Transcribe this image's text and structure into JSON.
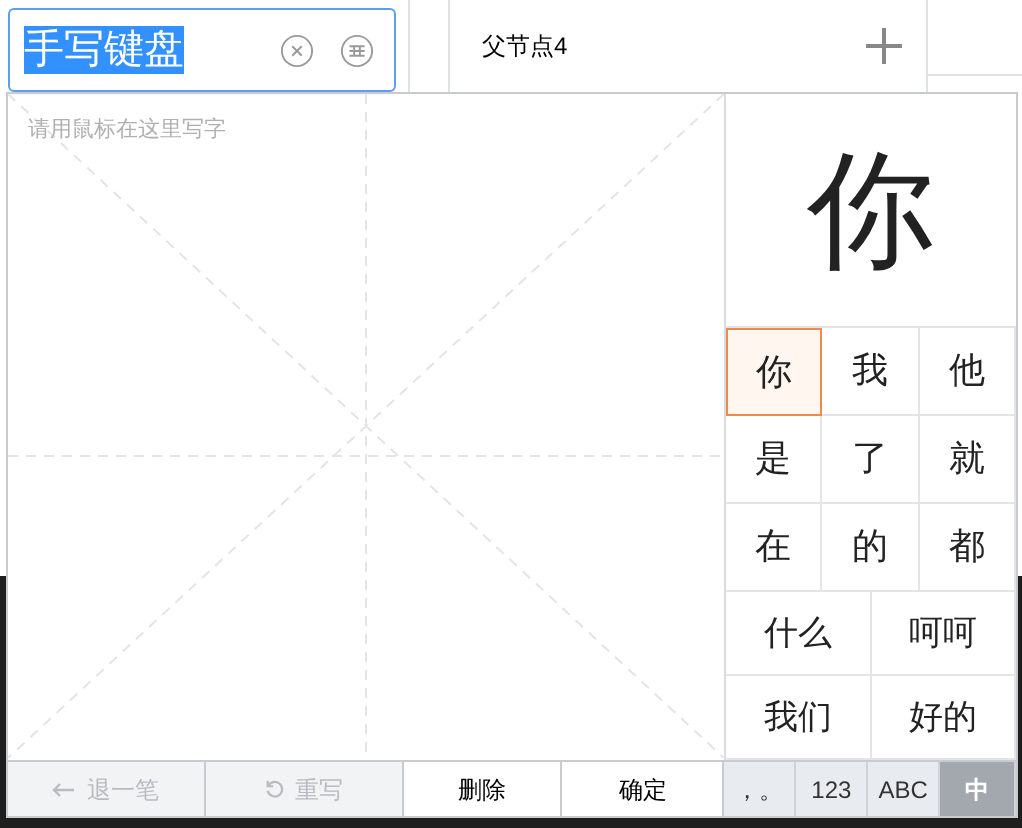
{
  "input": {
    "value": "手写键盘",
    "text_selected": true
  },
  "background": {
    "node_label": "父节点4"
  },
  "canvas": {
    "placeholder": "请用鼠标在这里写字"
  },
  "preview": "你",
  "candidates": [
    {
      "text": "你",
      "selected": true
    },
    {
      "text": "我",
      "selected": false
    },
    {
      "text": "他",
      "selected": false
    },
    {
      "text": "是",
      "selected": false
    },
    {
      "text": "了",
      "selected": false
    },
    {
      "text": "就",
      "selected": false
    },
    {
      "text": "在",
      "selected": false
    },
    {
      "text": "的",
      "selected": false
    },
    {
      "text": "都",
      "selected": false
    }
  ],
  "phrases": [
    {
      "text": "什么"
    },
    {
      "text": "呵呵"
    },
    {
      "text": "我们"
    },
    {
      "text": "好的"
    }
  ],
  "actions": [
    {
      "label": "退一笔",
      "kind": "undo",
      "disabled": true
    },
    {
      "label": "重写",
      "kind": "rewrite",
      "disabled": true
    },
    {
      "label": "删除",
      "kind": "delete",
      "disabled": false
    },
    {
      "label": "确定",
      "kind": "confirm",
      "disabled": false
    }
  ],
  "modes": [
    {
      "label": "，。",
      "selected": false
    },
    {
      "label": "123",
      "selected": false
    },
    {
      "label": "ABC",
      "selected": false
    },
    {
      "label": "中",
      "selected": true
    }
  ]
}
